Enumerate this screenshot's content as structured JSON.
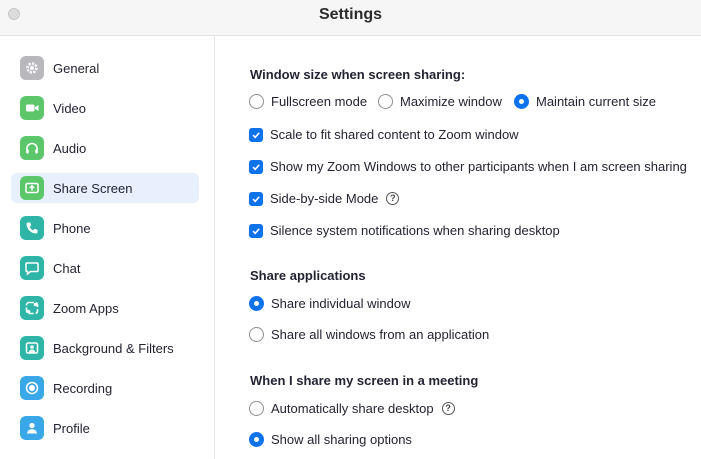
{
  "window": {
    "title": "Settings"
  },
  "sidebar": {
    "items": [
      {
        "label": "General",
        "icon": "gear-icon",
        "color": "#b8b8bd"
      },
      {
        "label": "Video",
        "icon": "video-camera-icon",
        "color": "#5cc66b"
      },
      {
        "label": "Audio",
        "icon": "headphones-icon",
        "color": "#5cc66b"
      },
      {
        "label": "Share Screen",
        "icon": "share-screen-icon",
        "color": "#5cc66b",
        "active": true
      },
      {
        "label": "Phone",
        "icon": "phone-icon",
        "color": "#2fb5a7"
      },
      {
        "label": "Chat",
        "icon": "chat-icon",
        "color": "#2fb5a7"
      },
      {
        "label": "Zoom Apps",
        "icon": "zoom-apps-icon",
        "color": "#2fb5a7"
      },
      {
        "label": "Background & Filters",
        "icon": "background-filters-icon",
        "color": "#2fb5a7"
      },
      {
        "label": "Recording",
        "icon": "recording-icon",
        "color": "#3aa7e8"
      },
      {
        "label": "Profile",
        "icon": "profile-icon",
        "color": "#3aa7e8"
      }
    ]
  },
  "sections": {
    "window_size": {
      "title": "Window size when screen sharing:",
      "radios": [
        {
          "label": "Fullscreen mode",
          "selected": false
        },
        {
          "label": "Maximize window",
          "selected": false
        },
        {
          "label": "Maintain current size",
          "selected": true
        }
      ],
      "checks": [
        {
          "label": "Scale to fit shared content to Zoom window",
          "checked": true
        },
        {
          "label": "Show my Zoom Windows to other participants when I am screen sharing",
          "checked": true
        },
        {
          "label": "Side-by-side Mode",
          "checked": true,
          "help": "?"
        },
        {
          "label": "Silence system notifications when sharing desktop",
          "checked": true
        }
      ]
    },
    "share_apps": {
      "title": "Share applications",
      "radios": [
        {
          "label": "Share individual window",
          "selected": true
        },
        {
          "label": "Share all windows from an application",
          "selected": false
        }
      ]
    },
    "meeting_share": {
      "title": "When I share my screen in a meeting",
      "radios": [
        {
          "label": "Automatically share desktop",
          "selected": false,
          "help": "?"
        },
        {
          "label": "Show all sharing options",
          "selected": true
        }
      ]
    }
  },
  "colors": {
    "accent": "#0e72ed",
    "active_bg": "#e7f0fc"
  }
}
